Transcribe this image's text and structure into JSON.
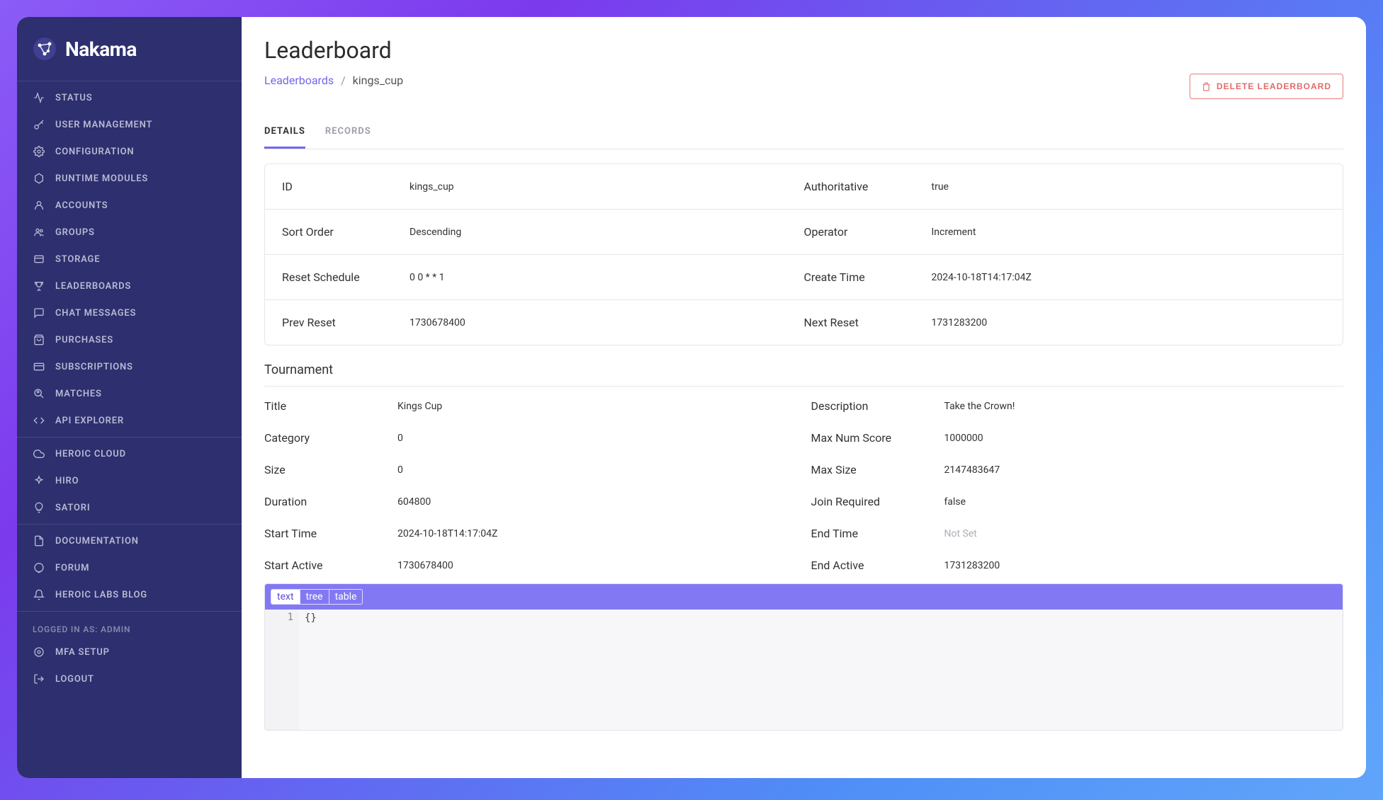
{
  "brand": {
    "name": "Nakama"
  },
  "sidebar": {
    "nav": [
      {
        "label": "STATUS",
        "icon": "activity-icon"
      },
      {
        "label": "USER MANAGEMENT",
        "icon": "key-icon"
      },
      {
        "label": "CONFIGURATION",
        "icon": "gear-icon"
      },
      {
        "label": "RUNTIME MODULES",
        "icon": "hexagon-icon"
      },
      {
        "label": "ACCOUNTS",
        "icon": "user-icon"
      },
      {
        "label": "GROUPS",
        "icon": "users-icon"
      },
      {
        "label": "STORAGE",
        "icon": "box-icon"
      },
      {
        "label": "LEADERBOARDS",
        "icon": "trophy-icon"
      },
      {
        "label": "CHAT MESSAGES",
        "icon": "message-icon"
      },
      {
        "label": "PURCHASES",
        "icon": "cart-icon"
      },
      {
        "label": "SUBSCRIPTIONS",
        "icon": "card-icon"
      },
      {
        "label": "MATCHES",
        "icon": "search-user-icon"
      },
      {
        "label": "API EXPLORER",
        "icon": "code-icon"
      }
    ],
    "external": [
      {
        "label": "HEROIC CLOUD",
        "icon": "cloud-icon"
      },
      {
        "label": "HIRO",
        "icon": "sparkle-icon"
      },
      {
        "label": "SATORI",
        "icon": "lightbulb-icon"
      }
    ],
    "docs": [
      {
        "label": "DOCUMENTATION",
        "icon": "file-icon"
      },
      {
        "label": "FORUM",
        "icon": "comment-icon"
      },
      {
        "label": "HEROIC LABS BLOG",
        "icon": "bell-icon"
      }
    ],
    "account": {
      "logged_text": "LOGGED IN AS: ADMIN",
      "mfa": "MFA SETUP",
      "logout": "LOGOUT"
    }
  },
  "header": {
    "title": "Leaderboard",
    "breadcrumb_parent": "Leaderboards",
    "breadcrumb_current": "kings_cup",
    "delete_button": "DELETE LEADERBOARD"
  },
  "tabs": {
    "details": "DETAILS",
    "records": "RECORDS"
  },
  "details": {
    "rows": [
      {
        "l1": "ID",
        "v1": "kings_cup",
        "l2": "Authoritative",
        "v2": "true"
      },
      {
        "l1": "Sort Order",
        "v1": "Descending",
        "l2": "Operator",
        "v2": "Increment"
      },
      {
        "l1": "Reset Schedule",
        "v1": "0 0 * * 1",
        "l2": "Create Time",
        "v2": "2024-10-18T14:17:04Z"
      },
      {
        "l1": "Prev Reset",
        "v1": "1730678400",
        "l2": "Next Reset",
        "v2": "1731283200"
      }
    ]
  },
  "tournament": {
    "section_label": "Tournament",
    "props": [
      {
        "l": "Title",
        "v": "Kings Cup"
      },
      {
        "l": "Description",
        "v": "Take the Crown!"
      },
      {
        "l": "Category",
        "v": "0"
      },
      {
        "l": "Max Num Score",
        "v": "1000000"
      },
      {
        "l": "Size",
        "v": "0"
      },
      {
        "l": "Max Size",
        "v": "2147483647"
      },
      {
        "l": "Duration",
        "v": "604800"
      },
      {
        "l": "Join Required",
        "v": "false"
      },
      {
        "l": "Start Time",
        "v": "2024-10-18T14:17:04Z"
      },
      {
        "l": "End Time",
        "v": "Not Set",
        "muted": true
      },
      {
        "l": "Start Active",
        "v": "1730678400"
      },
      {
        "l": "End Active",
        "v": "1731283200"
      }
    ]
  },
  "json_editor": {
    "tabs": {
      "text": "text",
      "tree": "tree",
      "table": "table"
    },
    "line_no": "1",
    "content": "{}"
  }
}
